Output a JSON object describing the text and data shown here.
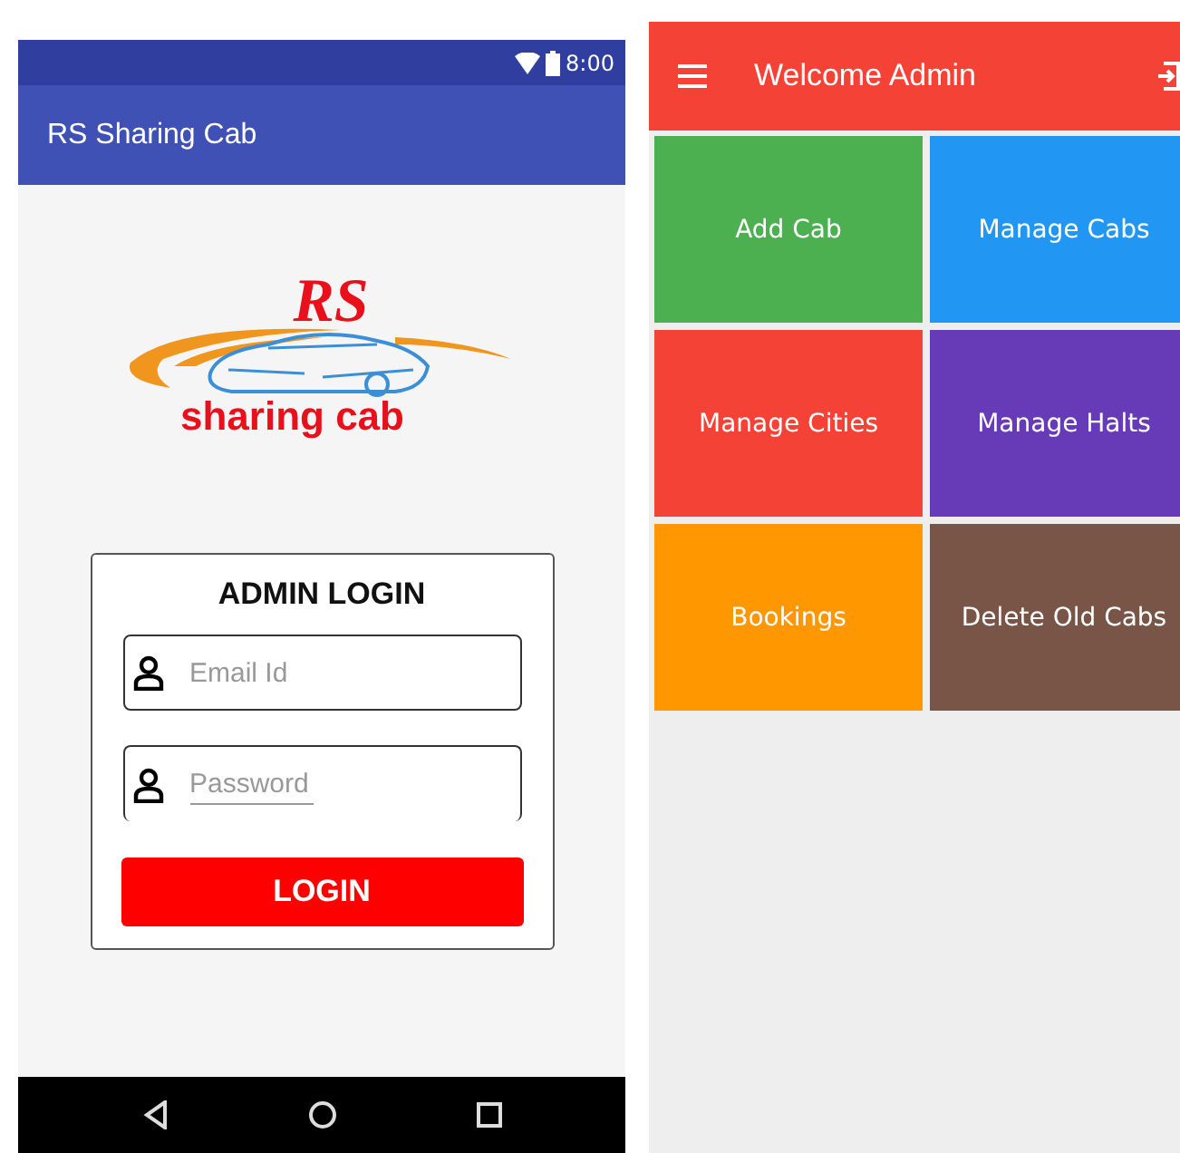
{
  "login_screen": {
    "status_bar": {
      "time": "8:00"
    },
    "app_bar": {
      "title": "RS Sharing Cab"
    },
    "logo": {
      "top": "RS",
      "bottom": "sharing cab"
    },
    "card": {
      "heading": "ADMIN LOGIN",
      "fields": [
        {
          "placeholder": "Email Id",
          "kind": "boxed"
        },
        {
          "placeholder": "Password",
          "kind": "underlined"
        }
      ],
      "button": "LOGIN"
    }
  },
  "admin_screen": {
    "app_bar": {
      "title": "Welcome Admin"
    },
    "tiles": [
      {
        "label": "Add Cab",
        "color": "#4caf50"
      },
      {
        "label": "Manage Cabs",
        "color": "#2196f3"
      },
      {
        "label": "Manage Cities",
        "color": "#f44336"
      },
      {
        "label": "Manage Halts",
        "color": "#673ab7"
      },
      {
        "label": "Bookings",
        "color": "#ff9800"
      },
      {
        "label": "Delete Old Cabs",
        "color": "#795548"
      }
    ]
  }
}
